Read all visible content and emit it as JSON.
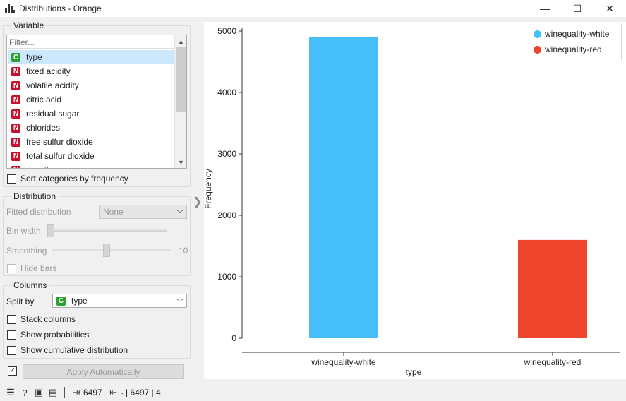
{
  "window": {
    "title": "Distributions - Orange",
    "minimize_glyph": "—",
    "maximize_glyph": "☐",
    "close_glyph": "✕"
  },
  "variable_group": {
    "title": "Variable",
    "filter_placeholder": "Filter...",
    "items": [
      {
        "type": "C",
        "label": "type"
      },
      {
        "type": "N",
        "label": "fixed acidity"
      },
      {
        "type": "N",
        "label": "volatile acidity"
      },
      {
        "type": "N",
        "label": "citric acid"
      },
      {
        "type": "N",
        "label": "residual sugar"
      },
      {
        "type": "N",
        "label": "chlorides"
      },
      {
        "type": "N",
        "label": "free sulfur dioxide"
      },
      {
        "type": "N",
        "label": "total sulfur dioxide"
      },
      {
        "type": "N",
        "label": "density"
      }
    ],
    "sort_label": "Sort categories by frequency"
  },
  "distribution_group": {
    "title": "Distribution",
    "fitted_label": "Fitted distribution",
    "fitted_value": "None",
    "bin_width_label": "Bin width",
    "bin_width_level": 0.0,
    "smoothing_label": "Smoothing",
    "smoothing_value": "10",
    "smoothing_level": 0.45,
    "hide_bars_label": "Hide bars"
  },
  "columns_group": {
    "title": "Columns",
    "split_by_label": "Split by",
    "split_by_type": "C",
    "split_by_value": "type",
    "stack_label": "Stack columns",
    "probabilities_label": "Show probabilities",
    "cumulative_label": "Show cumulative distribution"
  },
  "apply": {
    "checked_glyph": "✓",
    "label": "Apply Automatically"
  },
  "chart_data": {
    "type": "bar",
    "categories": [
      "winequality-white",
      "winequality-red"
    ],
    "values": [
      4898,
      1599
    ],
    "colors": [
      "#45bef9",
      "#ef452d"
    ],
    "xlabel": "type",
    "ylabel": "Frequency",
    "ylim": [
      0,
      5000
    ],
    "yticks": [
      0,
      1000,
      2000,
      3000,
      4000,
      5000
    ],
    "grid": false,
    "legend": {
      "position": "top-right",
      "entries": [
        {
          "label": "winequality-white",
          "color": "#45bef9"
        },
        {
          "label": "winequality-red",
          "color": "#ef452d"
        }
      ]
    }
  },
  "status": {
    "input_count": "6497",
    "output_text": "- | 6497 | 4"
  }
}
